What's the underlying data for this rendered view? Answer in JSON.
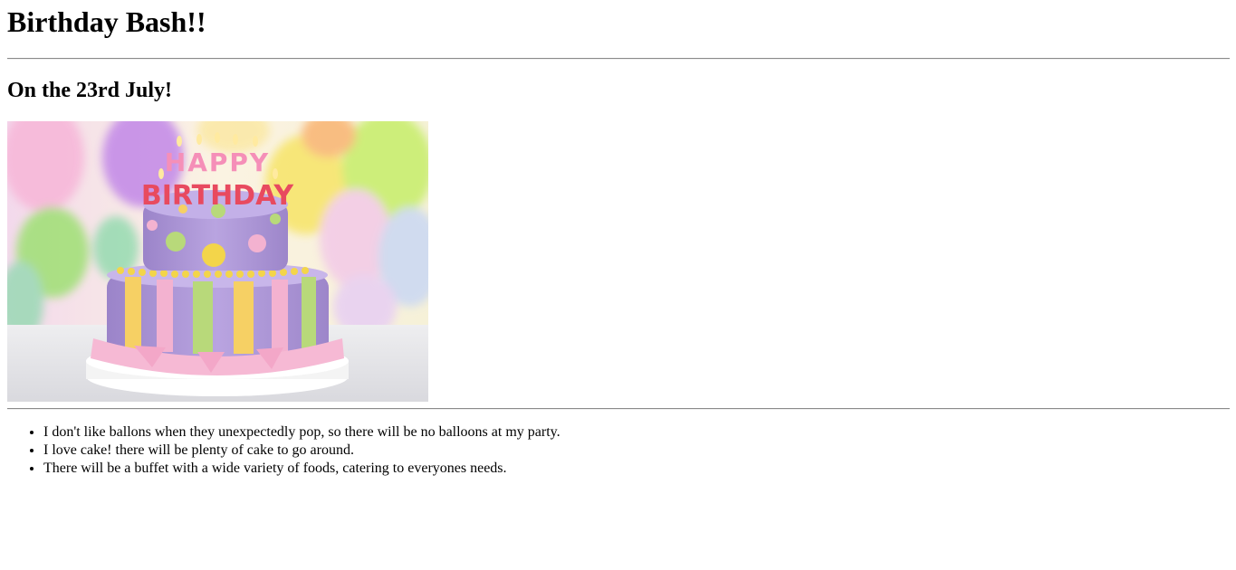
{
  "heading": "Birthday Bash!!",
  "subheading": "On the 23rd July!",
  "image": {
    "alt": "Two-tier purple birthday cake with HAPPY BIRTHDAY candles in front of colorful balloons",
    "candles_line1": "HAPPY",
    "candles_line2": "BIRTHDAY"
  },
  "notes": [
    "I don't like ballons when they unexpectedly pop, so there will be no balloons at my party.",
    "I love cake! there will be plenty of cake to go around.",
    "There will be a buffet with a wide variety of foods, catering to everyones needs."
  ]
}
